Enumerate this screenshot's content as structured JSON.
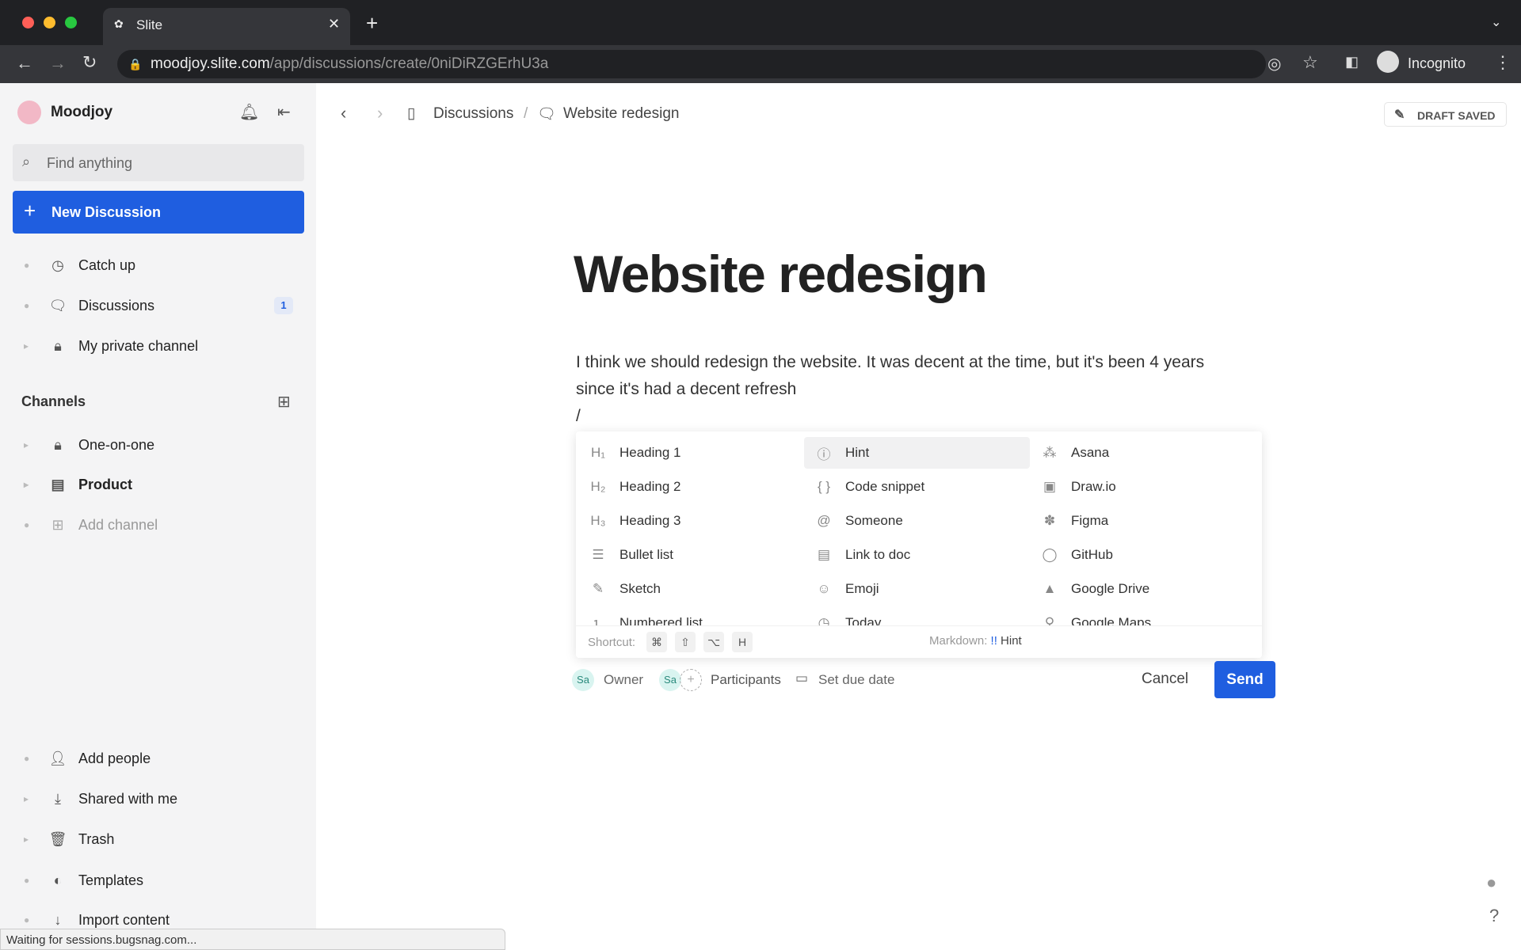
{
  "browser": {
    "tab_title": "Slite",
    "url_host": "moodjoy.slite.com",
    "url_path": "/app/discussions/create/0niDiRZGErhU3a",
    "profile": "Incognito"
  },
  "sidebar": {
    "workspace": "Moodjoy",
    "search_placeholder": "Find anything",
    "new_button": "New Discussion",
    "items": [
      {
        "label": "Catch up",
        "icon": "clock-icon"
      },
      {
        "label": "Discussions",
        "icon": "discussion-icon",
        "badge": "1"
      },
      {
        "label": "My private channel",
        "icon": "lock-icon"
      }
    ],
    "channels_heading": "Channels",
    "channels": [
      {
        "label": "One-on-one",
        "icon": "lock-icon"
      },
      {
        "label": "Product",
        "icon": "doc-icon"
      },
      {
        "label": "Add channel",
        "icon": "add-channel-icon"
      }
    ],
    "bottom": [
      {
        "label": "Add people"
      },
      {
        "label": "Shared with me"
      },
      {
        "label": "Trash"
      },
      {
        "label": "Templates"
      },
      {
        "label": "Import content"
      }
    ]
  },
  "header": {
    "breadcrumb": [
      "Discussions",
      "Website redesign"
    ],
    "status": "DRAFT SAVED"
  },
  "doc": {
    "title": "Website redesign",
    "body_line1": "I think we should redesign the website. It was decent at the time, but it's been 4 years",
    "body_line2": "since it's had a decent refresh",
    "input": "/"
  },
  "menu": {
    "col1": [
      "Heading 1",
      "Heading 2",
      "Heading 3",
      "Bullet list",
      "Sketch",
      "Numbered list"
    ],
    "col2": [
      "Hint",
      "Code snippet",
      "Someone",
      "Link to doc",
      "Emoji",
      "Today"
    ],
    "col3": [
      "Asana",
      "Draw.io",
      "Figma",
      "GitHub",
      "Google Drive",
      "Google Maps"
    ],
    "shortcut_label": "Shortcut:",
    "keys": [
      "⌘",
      "⇧",
      "⌥",
      "H"
    ],
    "markdown_label": "Markdown:",
    "markdown_prefix": "!!",
    "markdown_value": "Hint"
  },
  "footer": {
    "avatar": "Sa",
    "owner": "Owner",
    "participants": "Participants",
    "due": "Set due date",
    "cancel": "Cancel",
    "send": "Send"
  },
  "statusbar": "Waiting for sessions.bugsnag.com...",
  "accent": "#1f5ee0"
}
